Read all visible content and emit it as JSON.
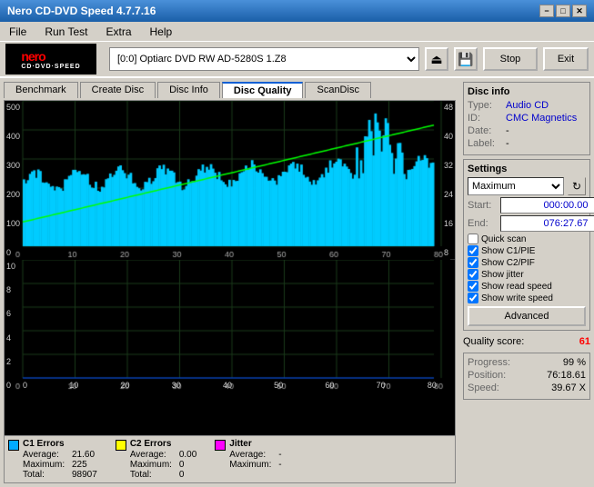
{
  "window": {
    "title": "Nero CD-DVD Speed 4.7.7.16"
  },
  "title_bar": {
    "title": "Nero CD-DVD Speed 4.7.7.16",
    "minimize": "−",
    "maximize": "□",
    "close": "✕"
  },
  "menu": {
    "items": [
      "File",
      "Run Test",
      "Extra",
      "Help"
    ]
  },
  "toolbar": {
    "drive": "[0:0]  Optiarc DVD RW AD-5280S 1.Z8",
    "stop_label": "Stop",
    "exit_label": "Exit"
  },
  "tabs": {
    "items": [
      "Benchmark",
      "Create Disc",
      "Disc Info",
      "Disc Quality",
      "ScanDisc"
    ],
    "active": "Disc Quality"
  },
  "chart_upper": {
    "y_left": [
      "500",
      "400",
      "300",
      "200",
      "100",
      "0"
    ],
    "y_right": [
      "48",
      "40",
      "32",
      "24",
      "16",
      "8"
    ],
    "x": [
      "0",
      "10",
      "20",
      "30",
      "40",
      "50",
      "60",
      "70",
      "80"
    ]
  },
  "chart_lower": {
    "y_left": [
      "10",
      "8",
      "6",
      "4",
      "2",
      "0"
    ],
    "x": [
      "0",
      "10",
      "20",
      "30",
      "40",
      "50",
      "60",
      "70",
      "80"
    ]
  },
  "legend": {
    "c1": {
      "label": "C1 Errors",
      "color": "#00aaff",
      "average_label": "Average:",
      "average_value": "21.60",
      "maximum_label": "Maximum:",
      "maximum_value": "225",
      "total_label": "Total:",
      "total_value": "98907"
    },
    "c2": {
      "label": "C2 Errors",
      "color": "#ffff00",
      "average_label": "Average:",
      "average_value": "0.00",
      "maximum_label": "Maximum:",
      "maximum_value": "0",
      "total_label": "Total:",
      "total_value": "0"
    },
    "jitter": {
      "label": "Jitter",
      "color": "#ff00ff",
      "average_label": "Average:",
      "average_value": "-",
      "maximum_label": "Maximum:",
      "maximum_value": "-"
    }
  },
  "disc_info": {
    "title": "Disc info",
    "type_label": "Type:",
    "type_value": "Audio CD",
    "id_label": "ID:",
    "id_value": "CMC Magnetics",
    "date_label": "Date:",
    "date_value": "-",
    "label_label": "Label:",
    "label_value": "-"
  },
  "settings": {
    "title": "Settings",
    "speed_option": "Maximum",
    "start_label": "Start:",
    "start_value": "000:00.00",
    "end_label": "End:",
    "end_value": "076:27.67",
    "checkboxes": {
      "quick_scan": {
        "label": "Quick scan",
        "checked": false
      },
      "show_c1_pie": {
        "label": "Show C1/PIE",
        "checked": true
      },
      "show_c2_pif": {
        "label": "Show C2/PIF",
        "checked": true
      },
      "show_jitter": {
        "label": "Show jitter",
        "checked": true
      },
      "show_read_speed": {
        "label": "Show read speed",
        "checked": true
      },
      "show_write_speed": {
        "label": "Show write speed",
        "checked": true
      }
    },
    "advanced_label": "Advanced"
  },
  "quality": {
    "score_label": "Quality score:",
    "score_value": "61"
  },
  "progress": {
    "progress_label": "Progress:",
    "progress_value": "99 %",
    "position_label": "Position:",
    "position_value": "76:18.61",
    "speed_label": "Speed:",
    "speed_value": "39.67 X"
  }
}
